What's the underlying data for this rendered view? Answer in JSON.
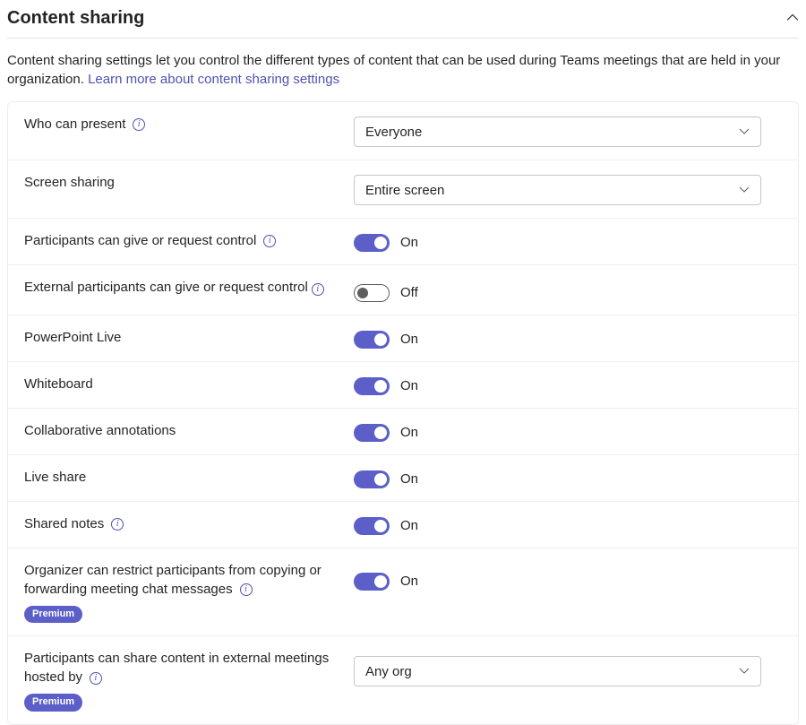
{
  "section": {
    "title": "Content sharing",
    "intro": "Content sharing settings let you control the different types of content that can be used during Teams meetings that are held in your organization. ",
    "learnMore": "Learn more about content sharing settings"
  },
  "badges": {
    "premium": "Premium"
  },
  "toggleText": {
    "on": "On",
    "off": "Off"
  },
  "rows": {
    "whoCanPresent": {
      "label": "Who can present",
      "hasInfo": true,
      "select": "Everyone"
    },
    "screenSharing": {
      "label": "Screen sharing",
      "hasInfo": false,
      "select": "Entire screen"
    },
    "giveRequest": {
      "label": "Participants can give or request control",
      "hasInfo": true,
      "toggle": true
    },
    "extGiveRequest": {
      "label": "External participants can give or request control",
      "hasInfo": true,
      "toggle": false
    },
    "pptLive": {
      "label": "PowerPoint Live",
      "toggle": true
    },
    "whiteboard": {
      "label": "Whiteboard",
      "toggle": true
    },
    "collabAnnot": {
      "label": "Collaborative annotations",
      "toggle": true
    },
    "liveShare": {
      "label": "Live share",
      "toggle": true
    },
    "sharedNotes": {
      "label": "Shared notes",
      "hasInfo": true,
      "toggle": true
    },
    "restrictCopy": {
      "label": "Organizer can restrict participants from copying or forwarding meeting chat messages",
      "hasInfo": true,
      "toggle": true,
      "premium": true
    },
    "shareExternal": {
      "label": "Participants can share content in external meetings hosted by",
      "hasInfo": true,
      "select": "Any org",
      "premium": true
    }
  }
}
